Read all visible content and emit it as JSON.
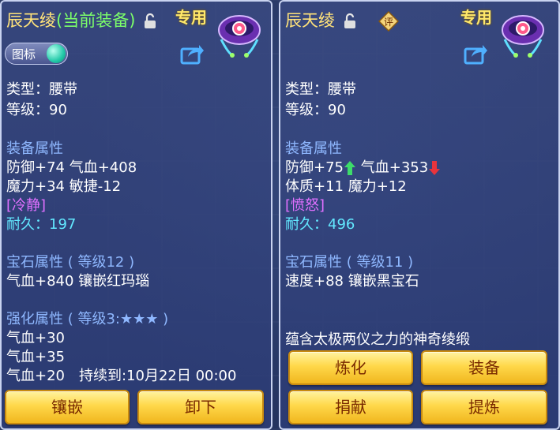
{
  "left": {
    "title_name": "辰天绫",
    "title_equipped": "(当前装备)",
    "special_label": "专用",
    "toggle_label": "图标",
    "type_line": "类型：腰带",
    "level_line": "等级：90",
    "equip_attr_header": "装备属性",
    "attr_line1": "防御+74 气血+408",
    "attr_line2": "魔力+34 敏捷-12",
    "special_trait": "[冷静]",
    "durability": "耐久：197",
    "gem_header": "宝石属性 ( 等级12 )",
    "gem_line": "气血+840 镶嵌红玛瑙",
    "enhance_header": "强化属性 ( 等级3:★★★ )",
    "enhance_line1": "气血+30",
    "enhance_line2": "气血+35",
    "enhance_line3": "气血+20　持续到:10月22日 00:00",
    "buttons": [
      "镶嵌",
      "卸下"
    ]
  },
  "right": {
    "title_name": "辰天绫",
    "rating_label": "评",
    "special_label": "专用",
    "type_line": "类型：腰带",
    "level_line": "等级：90",
    "equip_attr_header": "装备属性",
    "attr_def": "防御+75",
    "attr_hp": "气血+353",
    "attr_line2": "体质+11 魔力+12",
    "special_trait": "[愤怒]",
    "durability": "耐久：496",
    "gem_header": "宝石属性 ( 等级11 )",
    "gem_line": "速度+88 镶嵌黑宝石",
    "description": "蕴含太极两仪之力的神奇绫缎",
    "buttons": [
      "炼化",
      "装备",
      "捐献",
      "提炼"
    ]
  },
  "colors": {
    "title": "#ffe27a",
    "section": "#8fb8ff",
    "purple_trait": "#e070ff",
    "durability": "#62e8ff",
    "button": "#ffd84a",
    "up_arrow": "#3ddc6a",
    "down_arrow": "#e8343c"
  },
  "icons": [
    "lock-open-icon",
    "share-icon",
    "belt-item-icon",
    "rating-badge-icon",
    "arrow-up-icon",
    "arrow-down-icon"
  ]
}
